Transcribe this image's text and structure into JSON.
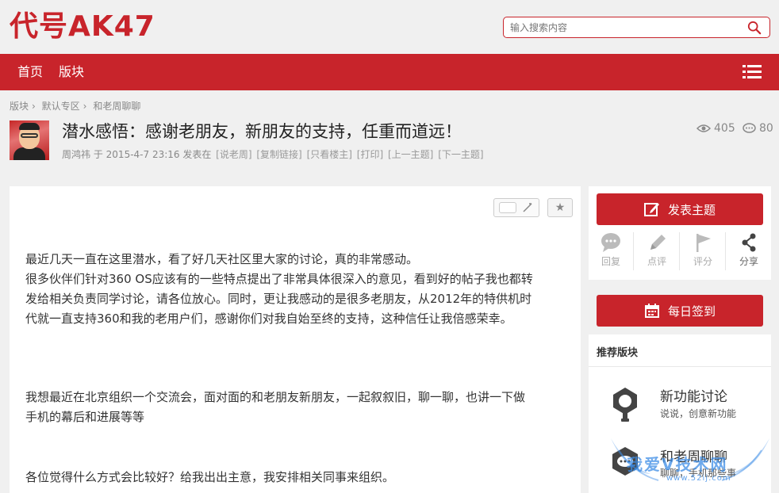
{
  "site": {
    "logo": "代号AK47",
    "search_placeholder": "输入搜索内容"
  },
  "nav": {
    "items": [
      "首页",
      "版块"
    ]
  },
  "breadcrumb": [
    "版块",
    "默认专区",
    "和老周聊聊"
  ],
  "post": {
    "title": "潜水感悟：感谢老朋友，新朋友的支持，任重而道远！",
    "author": "周鸿祎",
    "meta_mid": "于 2015-4-7 23:16 发表在",
    "links": [
      "[说老周]",
      "[复制链接]",
      "[只看楼主]",
      "[打印]",
      "[上一主题]",
      "[下一主题]"
    ],
    "views": "405",
    "replies": "80",
    "paragraphs": [
      "最近几天一直在这里潜水，看了好几天社区里大家的讨论，真的非常感动。",
      "很多伙伴们针对360 OS应该有的一些特点提出了非常具体很深入的意见，看到好的帖子我也都转",
      "发给相关负责同学讨论，请各位放心。同时，更让我感动的是很多老朋友，从2012年的特供机时",
      "代就一直支持360和我的老用户们，感谢你们对我自始至终的支持，这种信任让我倍感荣幸。",
      "我想最近在北京组织一个交流会，面对面的和老朋友新朋友，一起叙叙旧，聊一聊，也讲一下做",
      "手机的幕后和进展等等",
      "各位觉得什么方式会比较好？给我出出主意，我安排相关同事来组织。"
    ]
  },
  "sidebar": {
    "new_topic": "发表主题",
    "actions": [
      "回复",
      "点评",
      "评分",
      "分享"
    ],
    "checkin": "每日签到",
    "recommend_title": "推荐版块",
    "forums": [
      {
        "name": "新功能讨论",
        "desc": "说说，创意新功能"
      },
      {
        "name": "和老周聊聊",
        "desc": "聊聊，手机那些事"
      }
    ]
  },
  "watermark": {
    "text": "我爱V技术网",
    "url": "www.52ij.com"
  },
  "colors": {
    "brand": "#c8242b",
    "background": "#f0f0f0"
  }
}
